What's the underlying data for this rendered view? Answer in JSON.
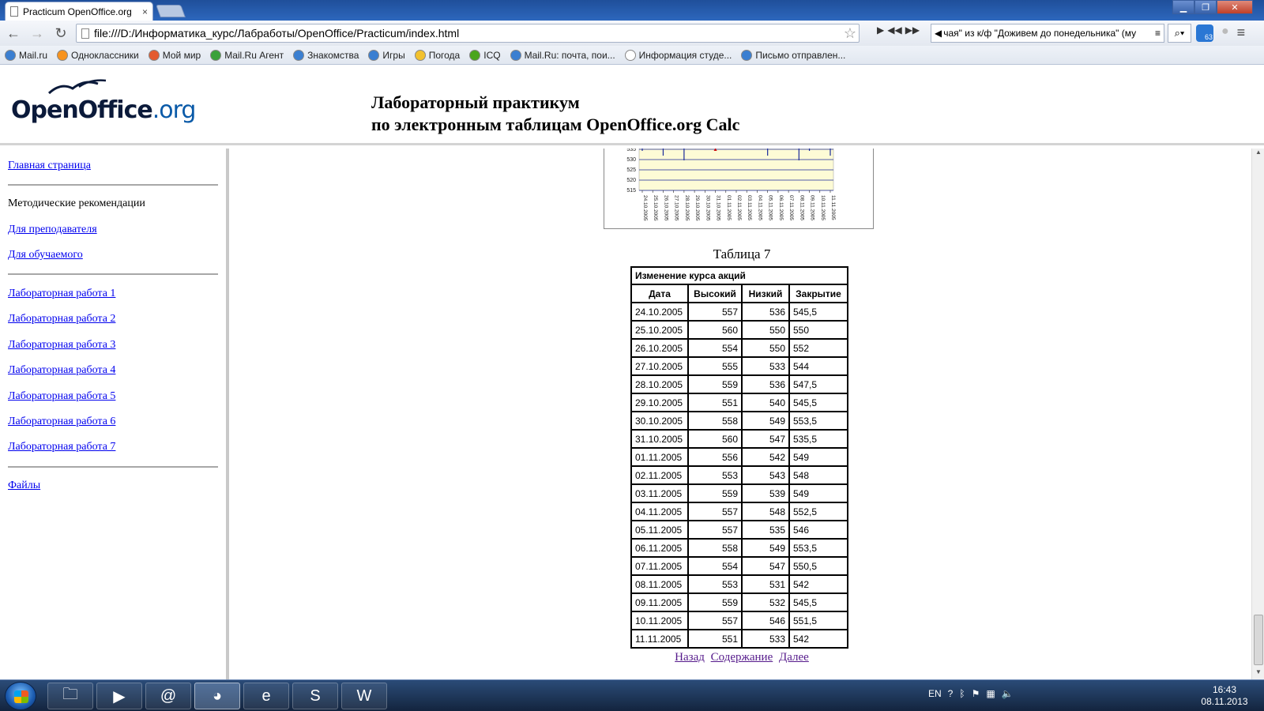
{
  "browser": {
    "tab_title": "Practicum OpenOffice.org",
    "tab_close": "×",
    "address": "file:///D:/Информатика_курс/Лабработы/OpenOffice/Practicum/index.html",
    "ticker": "чая\" из к/ф \"Доживем до понедельника\" (му",
    "ext_badge": "63",
    "bookmarks": [
      {
        "label": "Mail.ru",
        "color": "#3b7fd1"
      },
      {
        "label": "Одноклассники",
        "color": "#f7931e"
      },
      {
        "label": "Мой мир",
        "color": "#e35b2f"
      },
      {
        "label": "Mail.Ru Агент",
        "color": "#3aa13a"
      },
      {
        "label": "Знакомства",
        "color": "#3b7fd1"
      },
      {
        "label": "Игры",
        "color": "#3b7fd1"
      },
      {
        "label": "Погода",
        "color": "#f2c12e"
      },
      {
        "label": "ICQ",
        "color": "#4aa51c"
      },
      {
        "label": "Mail.Ru: почта, пои...",
        "color": "#3b7fd1"
      },
      {
        "label": "Информация студе...",
        "color": "#ffffff"
      },
      {
        "label": "Письмо отправлен...",
        "color": "#3b7fd1"
      }
    ]
  },
  "header": {
    "logo_main": "OpenOffice",
    "logo_org": ".org",
    "title_line1": "Лабораторный практикум",
    "title_line2": "по электронным таблицам OpenOffice.org Calc"
  },
  "sidebar": {
    "home": "Главная страница",
    "methodical": "Методические рекомендации",
    "for_teacher": "Для преподавателя",
    "for_student": "Для обучаемого",
    "labs": [
      "Лабораторная работа 1",
      "Лабораторная работа 2",
      "Лабораторная работа 3",
      "Лабораторная работа 4",
      "Лабораторная работа 5",
      "Лабораторная работа 6",
      "Лабораторная работа 7"
    ],
    "files": "Файлы"
  },
  "table": {
    "caption": "Таблица 7",
    "title": "Изменение курса акций",
    "headers": [
      "Дата",
      "Высокий",
      "Низкий",
      "Закрытие"
    ],
    "rows": [
      [
        "24.10.2005",
        "557",
        "536",
        "545,5"
      ],
      [
        "25.10.2005",
        "560",
        "550",
        "550"
      ],
      [
        "26.10.2005",
        "554",
        "550",
        "552"
      ],
      [
        "27.10.2005",
        "555",
        "533",
        "544"
      ],
      [
        "28.10.2005",
        "559",
        "536",
        "547,5"
      ],
      [
        "29.10.2005",
        "551",
        "540",
        "545,5"
      ],
      [
        "30.10.2005",
        "558",
        "549",
        "553,5"
      ],
      [
        "31.10.2005",
        "560",
        "547",
        "535,5"
      ],
      [
        "01.11.2005",
        "556",
        "542",
        "549"
      ],
      [
        "02.11.2005",
        "553",
        "543",
        "548"
      ],
      [
        "03.11.2005",
        "559",
        "539",
        "549"
      ],
      [
        "04.11.2005",
        "557",
        "548",
        "552,5"
      ],
      [
        "05.11.2005",
        "557",
        "535",
        "546"
      ],
      [
        "06.11.2005",
        "558",
        "549",
        "553,5"
      ],
      [
        "07.11.2005",
        "554",
        "547",
        "550,5"
      ],
      [
        "08.11.2005",
        "553",
        "531",
        "542"
      ],
      [
        "09.11.2005",
        "559",
        "532",
        "545,5"
      ],
      [
        "10.11.2005",
        "557",
        "546",
        "551,5"
      ],
      [
        "11.11.2005",
        "551",
        "533",
        "542"
      ]
    ]
  },
  "chart": {
    "y_ticks": [
      "535",
      "530",
      "525",
      "520",
      "515"
    ],
    "x_ticks": [
      "24.10.2005",
      "25.10.2005",
      "26.10.2005",
      "27.10.2005",
      "28.10.2005",
      "29.10.2005",
      "30.10.2005",
      "31.10.2005",
      "01.11.2005",
      "02.11.2005",
      "03.11.2005",
      "04.11.2005",
      "05.11.2005",
      "06.11.2005",
      "07.11.2005",
      "08.11.2005",
      "09.11.2005",
      "10.11.2005",
      "11.11.2005"
    ],
    "plot_bg": "#fdfbd6",
    "line_color": "#1a2a9a",
    "marker_color": "#d01010"
  },
  "nav": {
    "back": "Назад",
    "contents": "Содержание",
    "next": "Далее"
  },
  "taskbar": {
    "lang": "EN",
    "time": "16:43",
    "date": "08.11.2013"
  }
}
